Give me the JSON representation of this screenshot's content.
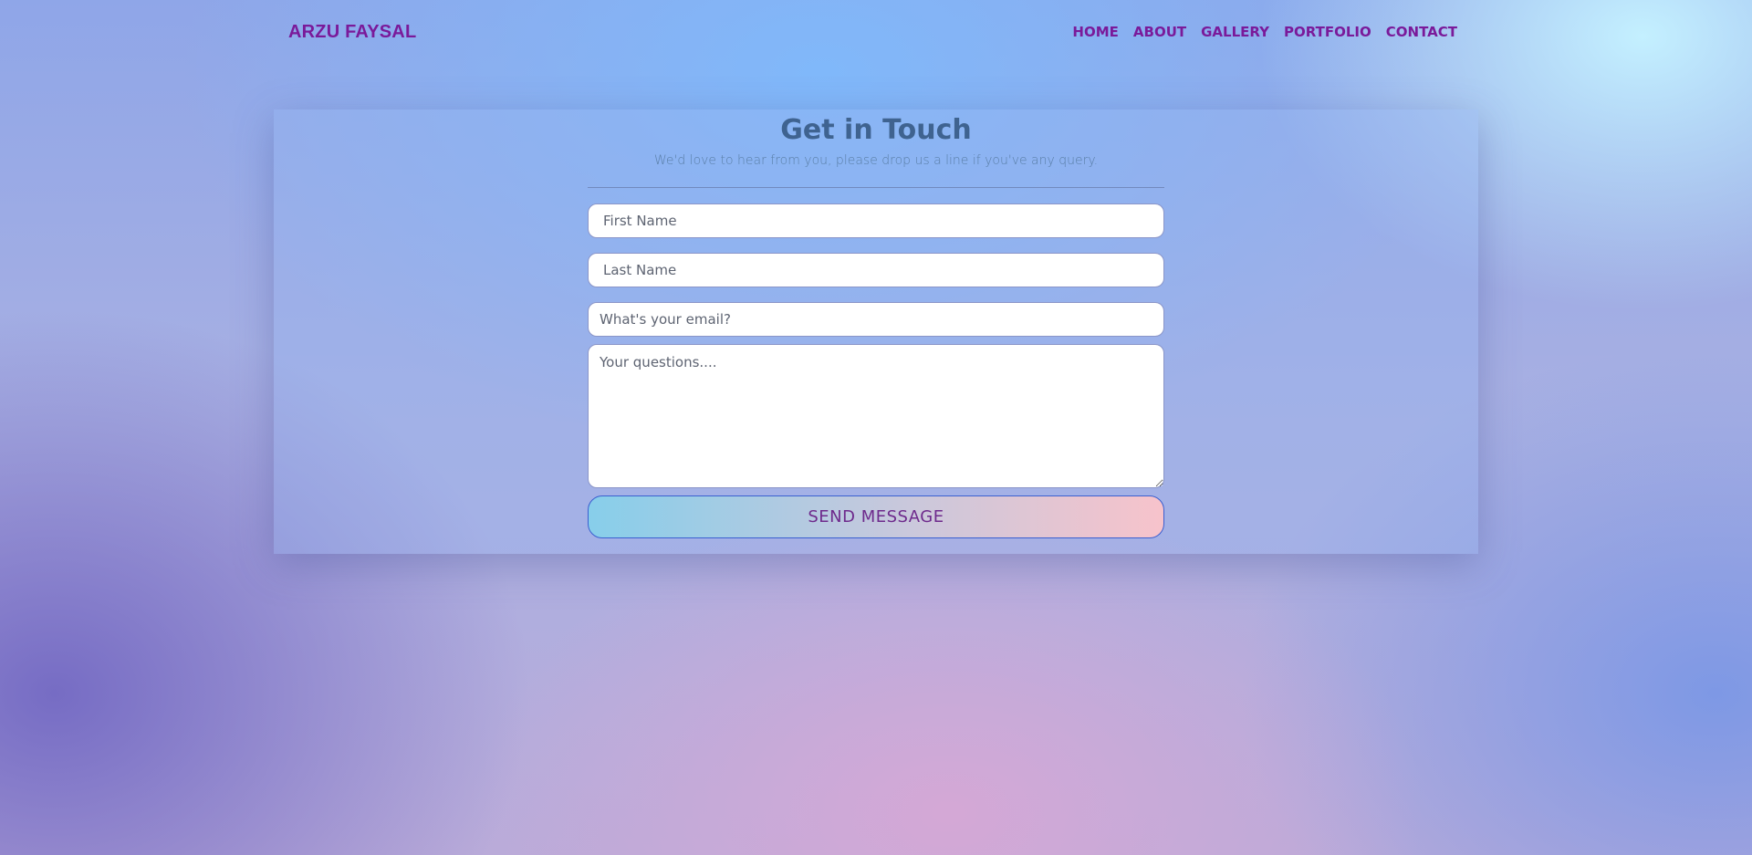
{
  "header": {
    "brand": "ARZU FAYSAL",
    "nav": [
      {
        "label": "HOME"
      },
      {
        "label": "ABOUT"
      },
      {
        "label": "GALLERY"
      },
      {
        "label": "PORTFOLIO"
      },
      {
        "label": "CONTACT"
      }
    ]
  },
  "contact": {
    "title": "Get in Touch",
    "subtitle": "We'd love to hear from you, please drop us a line if you've any query.",
    "first_name_placeholder": "First Name",
    "last_name_placeholder": "Last Name",
    "email_placeholder": "What's your email?",
    "message_placeholder": "Your questions....",
    "send_label": "SEND MESSAGE"
  },
  "colors": {
    "brand": "#7a1a9a",
    "title": "#3f6390",
    "button_border": "#3a5fd0"
  }
}
